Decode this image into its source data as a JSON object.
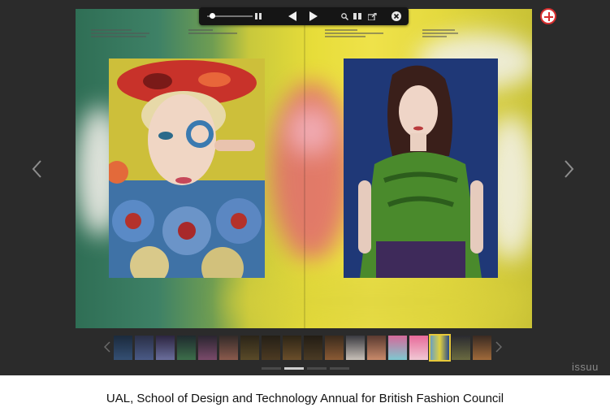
{
  "viewer": {
    "toolbar": {
      "zoom_slider": {
        "level": 0.1
      },
      "icons": [
        "zoom-slider-icon",
        "pause-icon",
        "prev-page-icon",
        "next-page-icon",
        "search-icon",
        "table-of-contents-icon",
        "share-icon",
        "close-icon"
      ]
    },
    "add_button_icon": "plus-icon",
    "nav": {
      "prev_icon": "chevron-left-icon",
      "next_icon": "chevron-right-icon"
    },
    "thumbnails": {
      "count": 18,
      "selected_index": 15,
      "selected_color": "#e7c83a"
    },
    "pager": {
      "pages": 4,
      "current": 1
    },
    "brand": "issuu"
  },
  "caption": "UAL, School of Design and Technology Annual for British Fashion Council"
}
